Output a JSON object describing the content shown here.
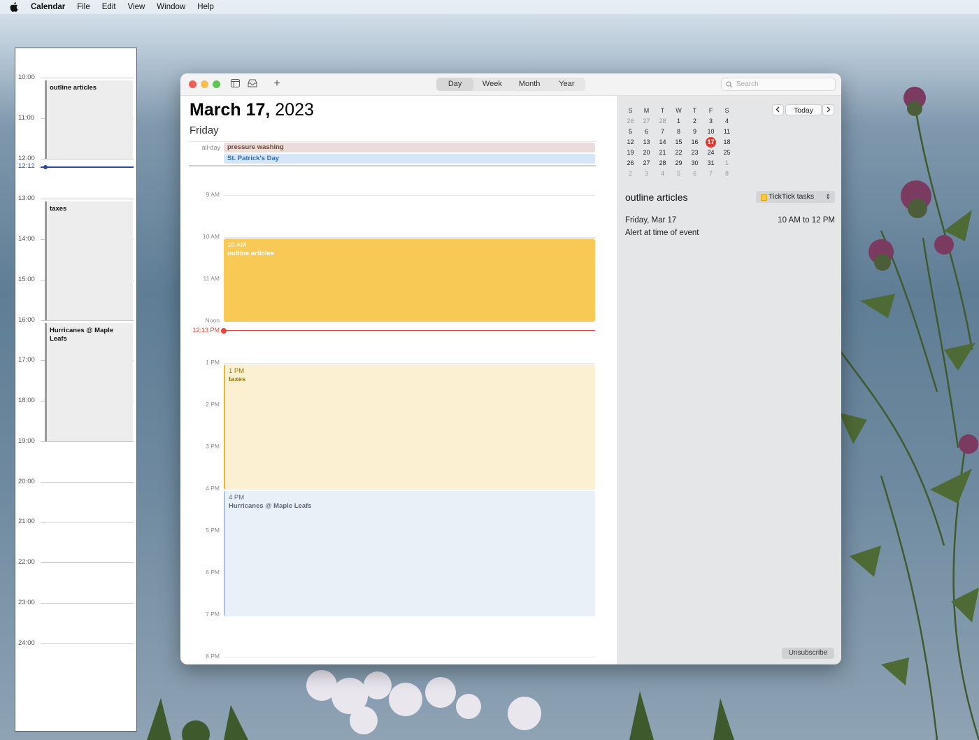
{
  "menubar": {
    "app": "Calendar",
    "items": [
      "File",
      "Edit",
      "View",
      "Window",
      "Help"
    ]
  },
  "strip": {
    "hours": [
      "10:00",
      "11:00",
      "12:00",
      "13:00",
      "14:00",
      "15:00",
      "16:00",
      "17:00",
      "18:00",
      "19:00",
      "20:00",
      "21:00",
      "22:00",
      "23:00",
      "24:00"
    ],
    "now_label": "12:12",
    "events": [
      "outline articles",
      "taxes",
      "Hurricanes @ Maple Leafs"
    ]
  },
  "window": {
    "views": [
      "Day",
      "Week",
      "Month",
      "Year"
    ],
    "active_view": "Day",
    "search_placeholder": "Search",
    "date_bold": "March 17,",
    "year": "2023",
    "weekday": "Friday",
    "allday_label": "all-day",
    "allday_events": [
      {
        "title": "pressure washing",
        "color": "#eadcd8",
        "text_color": "#6e4a40"
      },
      {
        "title": "St. Patrick's Day",
        "color": "#d6e6f8",
        "text_color": "#2d6cb8"
      }
    ],
    "time_labels": [
      "9 AM",
      "10 AM",
      "11 AM",
      "Noon",
      "1 PM",
      "2 PM",
      "3 PM",
      "4 PM",
      "5 PM",
      "6 PM",
      "7 PM",
      "8 PM"
    ],
    "now_label": "12:13 PM",
    "events": [
      {
        "time": "10 AM",
        "title": "outline articles",
        "color": "#f8c955",
        "text_color": "#ffffff"
      },
      {
        "time": "1 PM",
        "title": "taxes",
        "color": "#fcf0d3",
        "text_color": "#9a7210",
        "border": "#f0b52a"
      },
      {
        "time": "4 PM",
        "title": "Hurricanes @ Maple Leafs",
        "color": "#e9f0f8",
        "text_color": "#5a6a80",
        "border": "#a9c2e2"
      }
    ]
  },
  "sidebar": {
    "today_button": "Today",
    "weekday_headers": [
      "S",
      "M",
      "T",
      "W",
      "T",
      "F",
      "S"
    ],
    "month_rows": [
      [
        "26",
        "27",
        "28",
        "1",
        "2",
        "3",
        "4"
      ],
      [
        "5",
        "6",
        "7",
        "8",
        "9",
        "10",
        "11"
      ],
      [
        "12",
        "13",
        "14",
        "15",
        "16",
        "17",
        "18"
      ],
      [
        "19",
        "20",
        "21",
        "22",
        "23",
        "24",
        "25"
      ],
      [
        "26",
        "27",
        "28",
        "29",
        "30",
        "31",
        "1"
      ],
      [
        "2",
        "3",
        "4",
        "5",
        "6",
        "7",
        "8"
      ]
    ],
    "today": "17",
    "event_title": "outline articles",
    "calendar_name": "TickTick tasks",
    "event_date": "Friday, Mar 17",
    "event_range": "10 AM to 12 PM",
    "event_alert": "Alert at time of event",
    "unsubscribe": "Unsubscribe"
  }
}
